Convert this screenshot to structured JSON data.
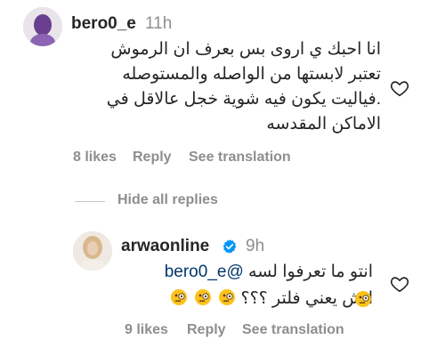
{
  "comments": [
    {
      "username": "bero0_e",
      "time": "11h",
      "lines": [
        "انا احبك ي اروى بس بعرف ان الرموش",
        "تعتبر لابستها من الواصله والمستوصله",
        ".فياليت يكون فيه شوية خجل عالاقل في",
        "الاماكن المقدسه"
      ],
      "likes": "8 likes",
      "reply": "Reply",
      "translate": "See translation",
      "heart_icon": "heart-outline-icon"
    }
  ],
  "hide_replies": "Hide all replies",
  "reply_comment": {
    "username": "arwaonline",
    "verified_icon": "verified-badge-icon",
    "verified_color": "#0095f6",
    "time": "9h",
    "mention": "@bero0_e",
    "line1": "انتو ما تعرفوا لسه",
    "line2": "ايش يعني فلتر ؟؟؟",
    "emojis": [
      "monocle-face-emoji",
      "monocle-face-emoji",
      "monocle-face-emoji",
      "monocle-face-emoji"
    ],
    "likes": "9 likes",
    "reply": "Reply",
    "translate": "See translation",
    "heart_icon": "heart-outline-icon"
  }
}
